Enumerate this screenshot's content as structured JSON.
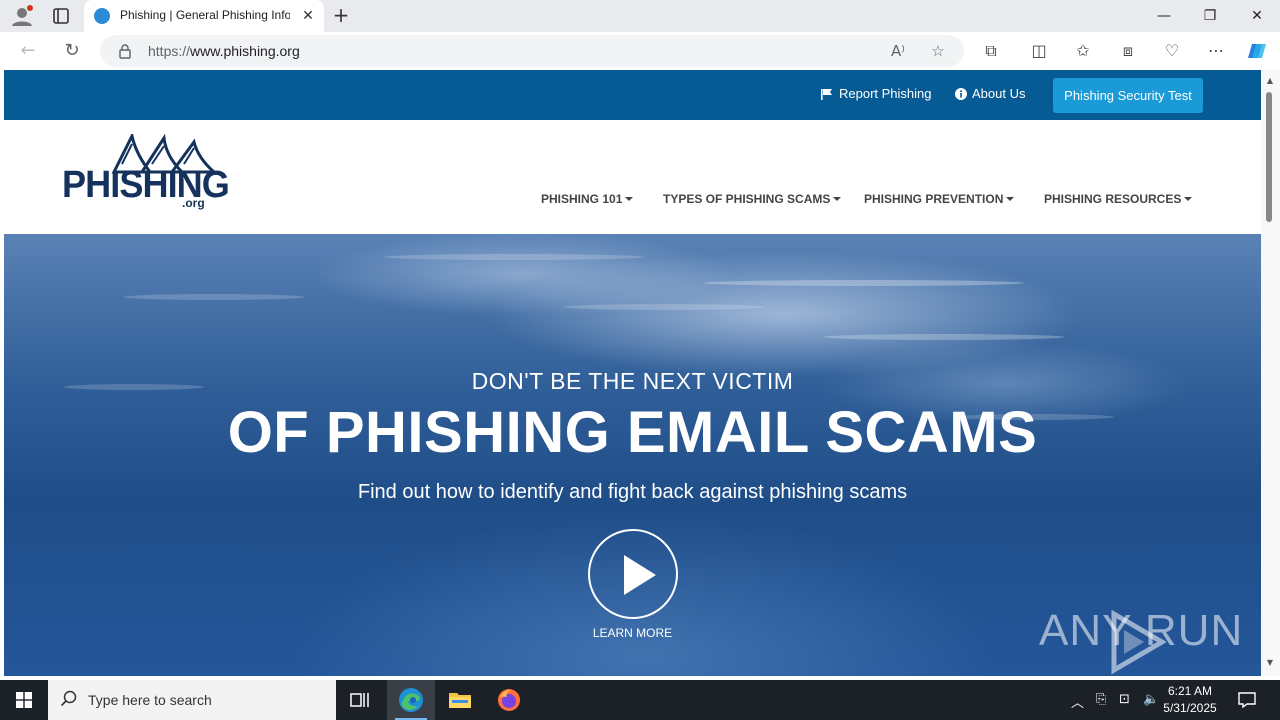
{
  "browser": {
    "tab_title": "Phishing | General Phishing Infor",
    "url_prefix": "https://",
    "url_host": "www.phishing.org",
    "window_controls": {
      "minimize": "—",
      "maximize": "❐",
      "close": "✕"
    }
  },
  "site": {
    "topbar": {
      "report_label": "Report Phishing",
      "about_label": "About Us",
      "security_test_label": "Phishing Security Test"
    },
    "logo": {
      "text": "PHISHING",
      "suffix": ".org"
    },
    "nav": [
      {
        "label": "PHISHING 101"
      },
      {
        "label": "TYPES OF PHISHING SCAMS"
      },
      {
        "label": "PHISHING PREVENTION"
      },
      {
        "label": "PHISHING RESOURCES"
      }
    ],
    "hero": {
      "kicker": "DON'T BE THE NEXT VICTIM",
      "title": "OF PHISHING EMAIL SCAMS",
      "subtitle": "Find out how to identify and fight back against phishing scams",
      "cta_label": "LEARN MORE"
    },
    "watermark": "ANY  RUN"
  },
  "taskbar": {
    "search_placeholder": "Type here to search",
    "time": "6:21 AM",
    "date": "5/31/2025"
  },
  "colors": {
    "topbar": "#065b94",
    "security_button": "#1a9ad6",
    "logo_navy": "#14325c",
    "taskbar": "#1c2027"
  }
}
